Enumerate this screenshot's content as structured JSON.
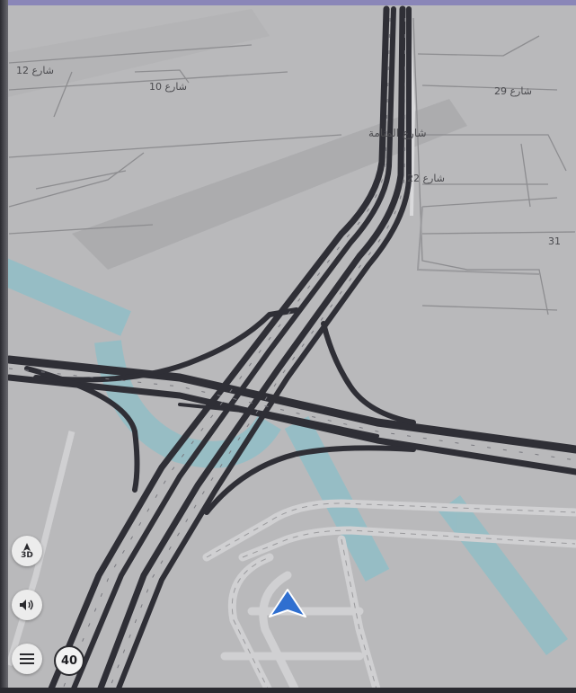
{
  "streets": {
    "s12": "شارع 12",
    "s10": "شارع 10",
    "s29": "شارع 29",
    "manama": "شارع المنامة",
    "s22": "شارع 22",
    "s31": "31"
  },
  "controls": {
    "view_mode": "3D",
    "speed_limit": "40"
  },
  "icons": {
    "compass": "compass-arrow-icon",
    "volume": "speaker-icon",
    "menu": "hamburger-menu-icon",
    "position": "current-position-arrow-icon"
  },
  "colors": {
    "map_bg": "#b9b9bb",
    "road": "#2f2f36",
    "position": "#2f6fd0"
  }
}
